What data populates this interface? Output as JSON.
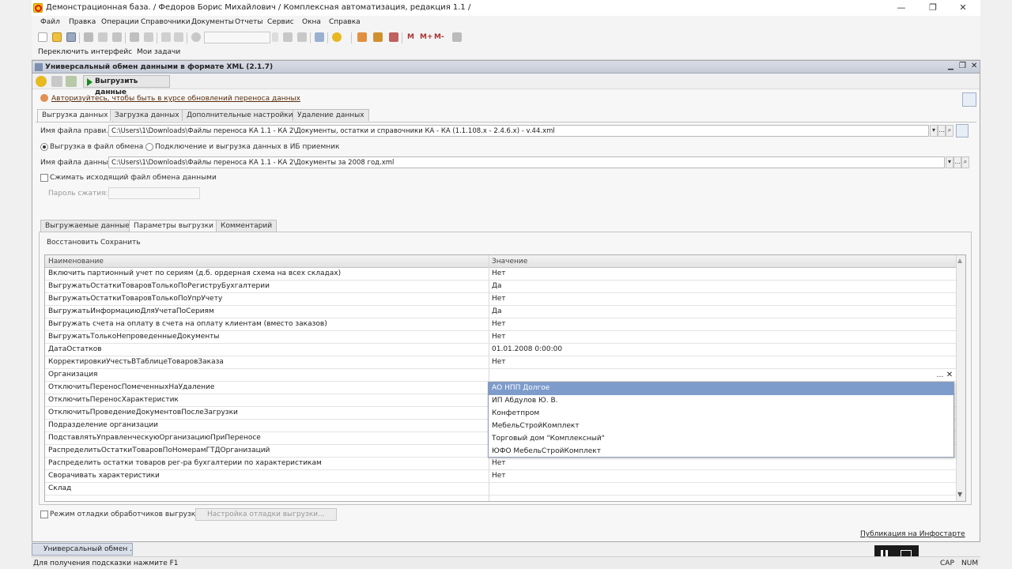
{
  "window": {
    "title": "Демонстрационная база. / Федоров Борис Михайлович /  Комплексная автоматизация, редакция 1.1 /",
    "minimize": "—",
    "maximize": "❐",
    "close": "✕"
  },
  "menu": [
    "Файл",
    "Правка",
    "Операции",
    "Справочники",
    "Документы",
    "Отчеты",
    "Сервис",
    "Окна",
    "Справка"
  ],
  "panel": {
    "switch_interface": "Переключить интерфейс",
    "my_tasks": "Мои задачи"
  },
  "form": {
    "title": "Универсальный обмен данными в формате XML (2.1.7)",
    "export_button": "Выгрузить данные",
    "auth_link": "Авторизуйтесь, чтобы быть в курсе обновлений переноса данных",
    "tabs": [
      "Выгрузка данных",
      "Загрузка данных",
      "Дополнительные настройки",
      "Удаление данных"
    ],
    "rules_file_label": "Имя файла прави...",
    "rules_file_value": "C:\\Users\\1\\Downloads\\Файлы переноса КА 1.1 - КА 2\\Документы, остатки и справочники КА - КА (1.1.108.x - 2.4.6.x) - v.44.xml",
    "radio_file": "Выгрузка в файл обмена",
    "radio_ib": "Подключение и выгрузка данных в ИБ приемник",
    "data_file_label": "Имя файла данных",
    "data_file_value": "C:\\Users\\1\\Downloads\\Файлы переноса КА 1.1 - КА 2\\Документы за 2008 год.xml",
    "compress_label": "Сжимать исходящий файл обмена данными",
    "password_label": "Пароль сжатия:",
    "subtabs": [
      "Выгружаемые данные",
      "Параметры выгрузки",
      "Комментарий"
    ],
    "restore": "Восстановить",
    "save": "Сохранить",
    "grid": {
      "col_name": "Наименование",
      "col_value": "Значение",
      "rows": [
        {
          "name": "Включить партионный учет по сериям (д.б. ордерная схема на всех складах)",
          "value": "Нет"
        },
        {
          "name": "ВыгружатьОстаткиТоваровТолькоПоРегиструБухгалтерии",
          "value": "Да"
        },
        {
          "name": "ВыгружатьОстаткиТоваровТолькоПоУпрУчету",
          "value": "Нет"
        },
        {
          "name": "ВыгружатьИнформациюДляУчетаПоСериям",
          "value": "Да"
        },
        {
          "name": "Выгружать счета на оплату в счета на оплату клиентам (вместо заказов)",
          "value": "Нет"
        },
        {
          "name": "ВыгружатьТолькоНепроведенныеДокументы",
          "value": "Нет"
        },
        {
          "name": "ДатаОстатков",
          "value": "01.01.2008 0:00:00"
        },
        {
          "name": "КорректировкиУчестьВТаблицеТоваровЗаказа",
          "value": "Нет"
        },
        {
          "name": "Организация",
          "value": ""
        },
        {
          "name": "ОтключитьПереносПомеченныхНаУдаление",
          "value": ""
        },
        {
          "name": "ОтключитьПереносХарактеристик",
          "value": ""
        },
        {
          "name": "ОтключитьПроведениеДокументовПослеЗагрузки",
          "value": ""
        },
        {
          "name": "Подразделение организации",
          "value": ""
        },
        {
          "name": "ПодставлятьУправленческуюОрганизациюПриПереносе",
          "value": ""
        },
        {
          "name": "РаспределитьОстаткиТоваровПоНомерамГТДОрганизаций",
          "value": ""
        },
        {
          "name": "Распределить остатки товаров рег-ра бухгалтерии по характеристикам",
          "value": "Нет"
        },
        {
          "name": "Сворачивать характеристики",
          "value": "Нет"
        },
        {
          "name": "Склад",
          "value": ""
        }
      ]
    },
    "dropdown": [
      "АО НПП Долгое",
      "ИП Абдулов Ю. В.",
      "Конфетпром",
      "МебельСтройКомплект",
      "Торговый дом \"Комплексный\"",
      "ЮФО МебельСтройКомплект"
    ],
    "debug_check": "Режим отладки обработчиков выгрузки",
    "debug_settings": "Настройка отладки выгрузки...",
    "publish_link": "Публикация на Инфостарте"
  },
  "taskbar": {
    "item": "Универсальный обмен ..."
  },
  "status": {
    "hint": "Для получения подсказки нажмите F1",
    "cap": "CAP",
    "num": "NUM"
  },
  "colors": {
    "selection": "#7d9ccc",
    "link": "#5a2d0c",
    "export_icon": "#1a8a1a"
  }
}
